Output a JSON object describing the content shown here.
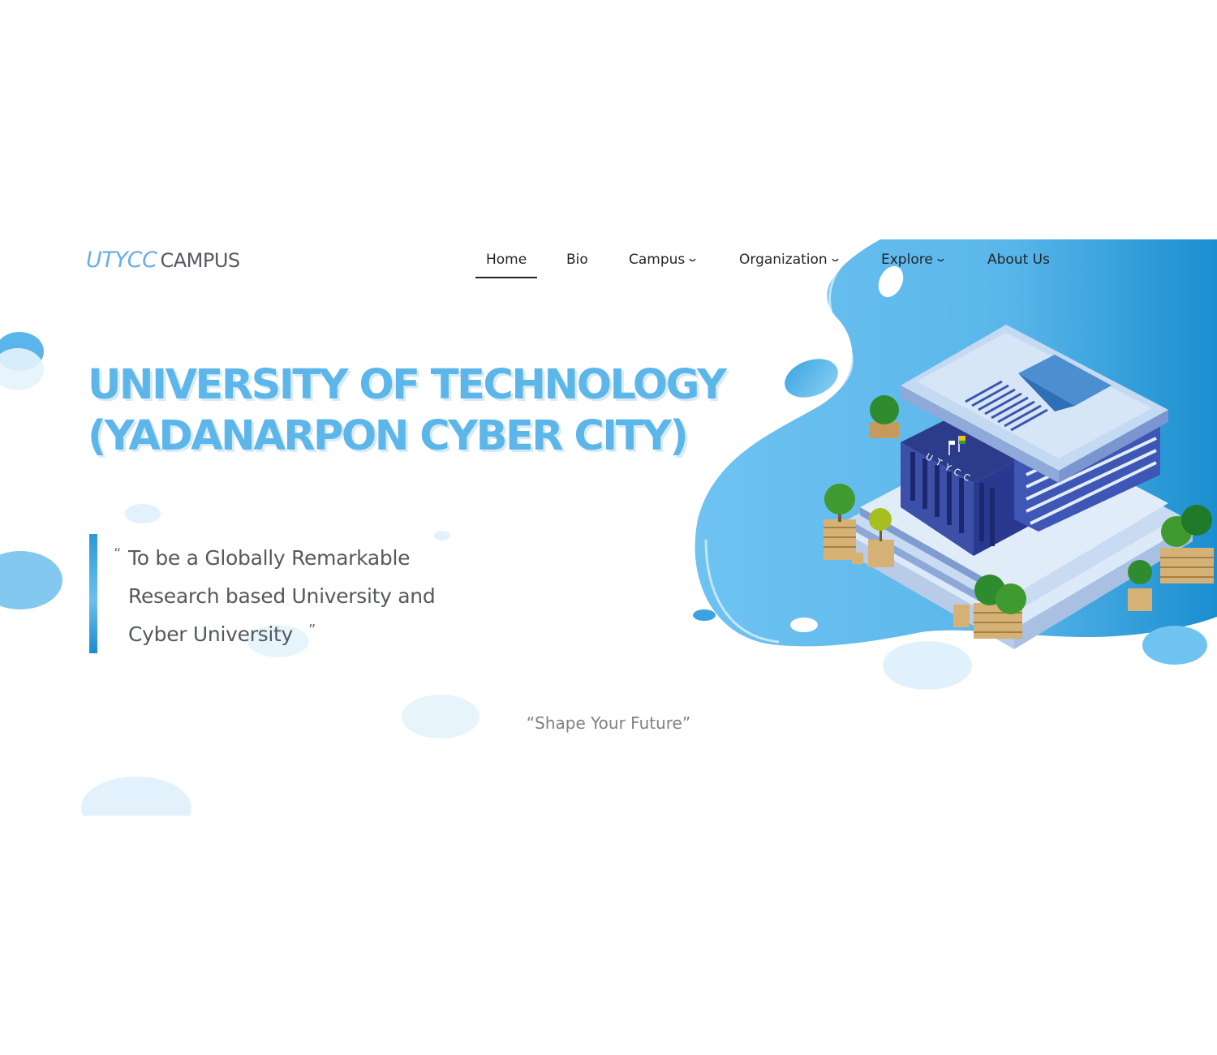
{
  "header": {
    "logo": {
      "brand": "UTYCC",
      "suffix": "CAMPUS"
    },
    "nav": {
      "home": "Home",
      "bio": "Bio",
      "campus": "Campus",
      "organization": "Organization",
      "explore": "Explore",
      "about": "About Us",
      "active": "Home"
    }
  },
  "hero": {
    "title_line1": "UNIVERSITY OF TECHNOLOGY",
    "title_line2": "(YADANARPON CYBER CITY)",
    "mission_open_quote": "“",
    "mission_text": "To be a Globally Remarkable Research based University and Cyber University",
    "mission_close_quote": "”",
    "slogan": "“Shape Your Future”",
    "building_label": "UTYCC"
  },
  "colors": {
    "accent": "#5cb6ea",
    "accent_deep": "#1b8ccf",
    "text_dark": "#1f2428",
    "text_muted": "#7d8185"
  }
}
